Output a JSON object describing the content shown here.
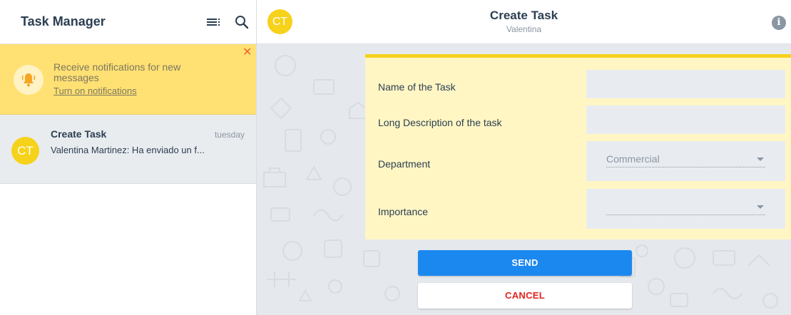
{
  "sidebar": {
    "app_title": "Task Manager",
    "notification": {
      "message": "Receive notifications for new messages",
      "link": "Turn on notifications",
      "close": "✕"
    },
    "chats": [
      {
        "avatar": "CT",
        "title": "Create Task",
        "time": "tuesday",
        "preview": "Valentina Martinez: Ha enviado un f..."
      }
    ]
  },
  "conversation": {
    "avatar": "CT",
    "title": "Create Task",
    "subtitle": "Valentina",
    "info": "i"
  },
  "form": {
    "fields": [
      {
        "label": "Name of the Task",
        "value": ""
      },
      {
        "label": "Long Description of the task",
        "value": ""
      },
      {
        "label": "Department",
        "value": "Commercial"
      },
      {
        "label": "Importance",
        "value": ""
      }
    ],
    "send_label": "SEND",
    "cancel_label": "CANCEL"
  },
  "colors": {
    "accent_yellow": "#f6d21b",
    "notification_bg": "#ffe073",
    "form_bg": "#fff6c4",
    "send_blue": "#1b88f0",
    "cancel_red": "#e0231d"
  }
}
